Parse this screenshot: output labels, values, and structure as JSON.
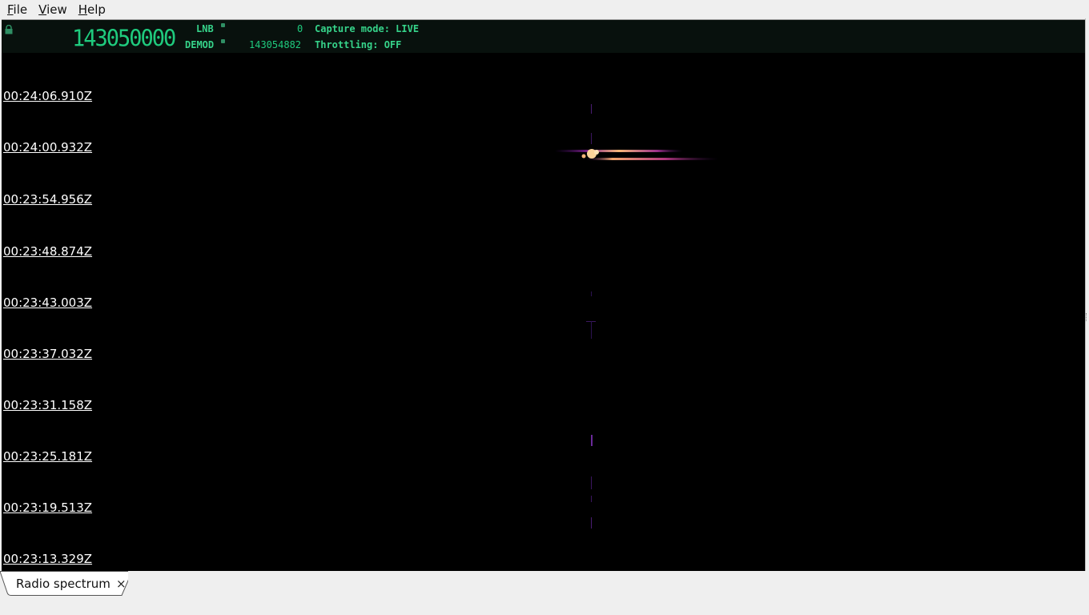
{
  "menu": {
    "file": {
      "mnemonic": "F",
      "rest": "ile"
    },
    "view": {
      "mnemonic": "V",
      "rest": "iew"
    },
    "help": {
      "mnemonic": "H",
      "rest": "elp"
    }
  },
  "header": {
    "frequency": "143050000",
    "lnb_label": "LNB",
    "lnb_value": "0",
    "demod_label": "DEMOD",
    "demod_value": "143054882",
    "capture_mode": "Capture mode: LIVE",
    "throttling": "Throttling: OFF",
    "accent_color": "#36d38a"
  },
  "waterfall": {
    "timestamps": [
      "00:24:06.910Z",
      "00:24:00.932Z",
      "00:23:54.956Z",
      "00:23:48.874Z",
      "00:23:43.003Z",
      "00:23:37.032Z",
      "00:23:31.158Z",
      "00:23:25.181Z",
      "00:23:19.513Z",
      "00:23:13.329Z"
    ]
  },
  "tabs": [
    {
      "label": "Radio spectrum",
      "close_icon": "×"
    }
  ]
}
